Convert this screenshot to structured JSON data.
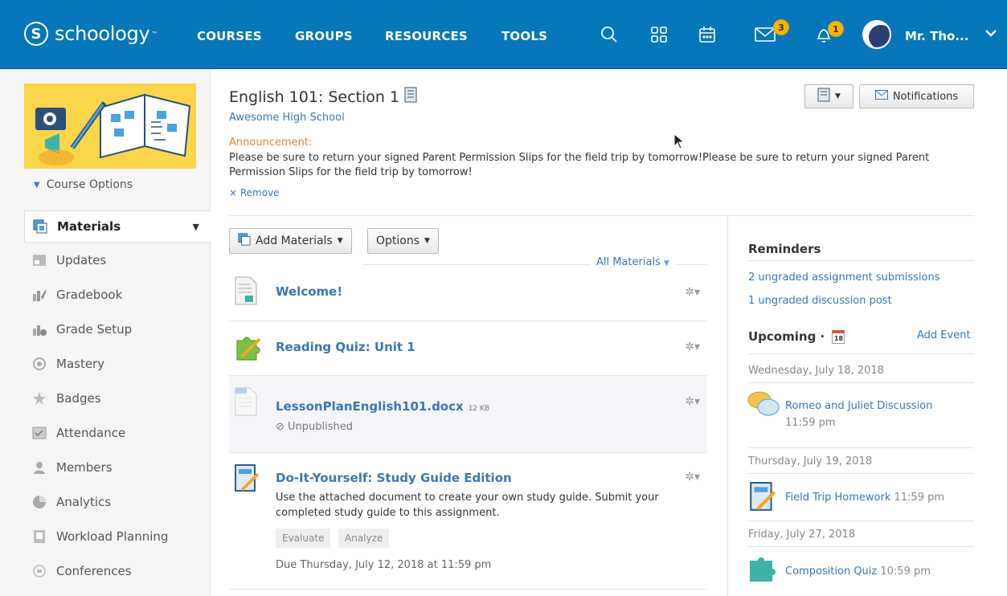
{
  "nav": {
    "logo": "schoology",
    "logo_s": "S",
    "links": [
      "COURSES",
      "GROUPS",
      "RESOURCES",
      "TOOLS"
    ],
    "icons": [
      "search-icon",
      "apps-grid-icon",
      "calendar-icon",
      "messages-icon",
      "notifications-bell-icon"
    ],
    "messages_badge": "3",
    "notifications_badge": "1",
    "user_name": "Mr. Tho..."
  },
  "colors": {
    "nav_bg": "#0677ba",
    "link": "#3a77b4",
    "announcement": "#f1812b",
    "badge": "#f4b400",
    "course_image_bg": "#fbd54a"
  },
  "sidebar": {
    "course_options": "Course Options",
    "items": [
      {
        "label": "Materials",
        "icon": "materials-icon"
      },
      {
        "label": "Updates",
        "icon": "updates-icon"
      },
      {
        "label": "Gradebook",
        "icon": "gradebook-icon"
      },
      {
        "label": "Grade Setup",
        "icon": "grade-setup-icon"
      },
      {
        "label": "Mastery",
        "icon": "mastery-icon"
      },
      {
        "label": "Badges",
        "icon": "badges-icon"
      },
      {
        "label": "Attendance",
        "icon": "attendance-icon"
      },
      {
        "label": "Members",
        "icon": "members-icon"
      },
      {
        "label": "Analytics",
        "icon": "analytics-icon"
      },
      {
        "label": "Workload Planning",
        "icon": "workload-planning-icon"
      },
      {
        "label": "Conferences",
        "icon": "conferences-icon"
      }
    ]
  },
  "header": {
    "title": "English 101: Section 1",
    "school": "Awesome High School",
    "announcement_label": "Announcement:",
    "announcement_text": "Please be sure to return your signed Parent Permission Slips for the field trip by tomorrow!Please be sure to return your signed Parent Permission Slips for the field trip by tomorrow!",
    "remove": "× Remove",
    "notifications_button": "Notifications"
  },
  "materials": {
    "add_materials": "Add Materials",
    "options": "Options",
    "filter": "All Materials",
    "items": [
      {
        "title": "Welcome!",
        "icon": "page-icon"
      },
      {
        "title": "Reading Quiz: Unit 1",
        "icon": "quiz-puzzle-icon"
      },
      {
        "title": "LessonPlanEnglish101.docx",
        "size": "12 KB",
        "status": "⊘ Unpublished",
        "icon": "word-document-icon"
      },
      {
        "title": "Do-It-Yourself: Study Guide Edition",
        "icon": "assignment-icon",
        "description": "Use the attached document to create your own study guide. Submit your completed study guide to this assignment.",
        "tags": [
          "Evaluate",
          "Analyze"
        ],
        "due": "Due Thursday, July 12, 2018 at 11:59 pm"
      }
    ]
  },
  "reminders": {
    "heading": "Reminders",
    "items": [
      "2 ungraded assignment submissions",
      "1 ungraded discussion post"
    ]
  },
  "upcoming": {
    "heading": "Upcoming ·",
    "calendar_day": "18",
    "add_event": "Add Event",
    "days": [
      {
        "date": "Wednesday, July 18, 2018",
        "event": "Romeo and Juliet Discussion",
        "time": "11:59 pm"
      },
      {
        "date": "Thursday, July 19, 2018",
        "event": "Field Trip Homework",
        "time": "11:59 pm"
      },
      {
        "date": "Friday, July 27, 2018",
        "event": "Composition Quiz",
        "time": "10:59 pm"
      }
    ]
  }
}
